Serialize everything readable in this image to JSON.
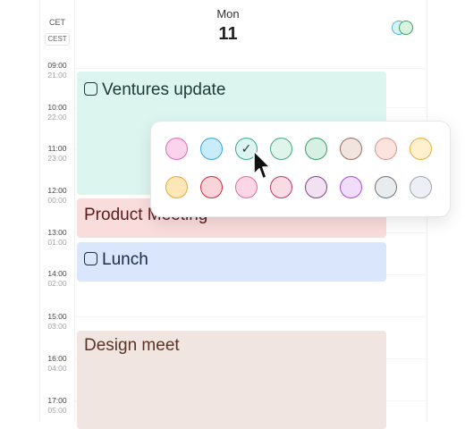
{
  "timezone": {
    "primary": "CET",
    "secondary": "CEST"
  },
  "day": {
    "name": "Mon",
    "number": "11"
  },
  "times": [
    {
      "primary": "09:00",
      "secondary": "21:00"
    },
    {
      "primary": "10:00",
      "secondary": "22:00"
    },
    {
      "primary": "11:00",
      "secondary": "23:00"
    },
    {
      "primary": "12:00",
      "secondary": "00:00"
    },
    {
      "primary": "13:00",
      "secondary": "01:00"
    },
    {
      "primary": "14:00",
      "secondary": "02:00"
    },
    {
      "primary": "15:00",
      "secondary": "03:00"
    },
    {
      "primary": "16:00",
      "secondary": "04:00"
    },
    {
      "primary": "17:00",
      "secondary": "05:00"
    }
  ],
  "events": {
    "ventures": {
      "title": "Ventures update"
    },
    "product": {
      "title": "Product Meeting"
    },
    "lunch": {
      "title": "Lunch"
    },
    "design": {
      "title": "Design meet"
    }
  },
  "color_picker": {
    "selected": "teal",
    "swatches": [
      {
        "name": "pink",
        "fill": "#fcd3ec",
        "border": "#e06bb7"
      },
      {
        "name": "sky-blue",
        "fill": "#c9ecfb",
        "border": "#38a6d6"
      },
      {
        "name": "teal",
        "fill": "#dcf5ef",
        "border": "#3aa89b"
      },
      {
        "name": "mint",
        "fill": "#dff5ec",
        "border": "#43a782"
      },
      {
        "name": "green",
        "fill": "#d6f1e3",
        "border": "#36a06a"
      },
      {
        "name": "brown",
        "fill": "#f1e4df",
        "border": "#9a6e5f"
      },
      {
        "name": "rose-beige",
        "fill": "#fbe3de",
        "border": "#d39a8c"
      },
      {
        "name": "yellow",
        "fill": "#fff1cf",
        "border": "#e8b33a"
      },
      {
        "name": "amber",
        "fill": "#fde7b9",
        "border": "#e6a832"
      },
      {
        "name": "red",
        "fill": "#fbd4d9",
        "border": "#d0283e"
      },
      {
        "name": "light-pink",
        "fill": "#fcd6e4",
        "border": "#e36c99"
      },
      {
        "name": "mauve",
        "fill": "#f9dbe3",
        "border": "#b53a64"
      },
      {
        "name": "purple",
        "fill": "#f1e1f1",
        "border": "#8c3d86"
      },
      {
        "name": "violet",
        "fill": "#f1dcfb",
        "border": "#a64ed8"
      },
      {
        "name": "slate",
        "fill": "#e9ecef",
        "border": "#6b7580"
      },
      {
        "name": "gray",
        "fill": "#eceff3",
        "border": "#9ea6b0"
      }
    ]
  }
}
